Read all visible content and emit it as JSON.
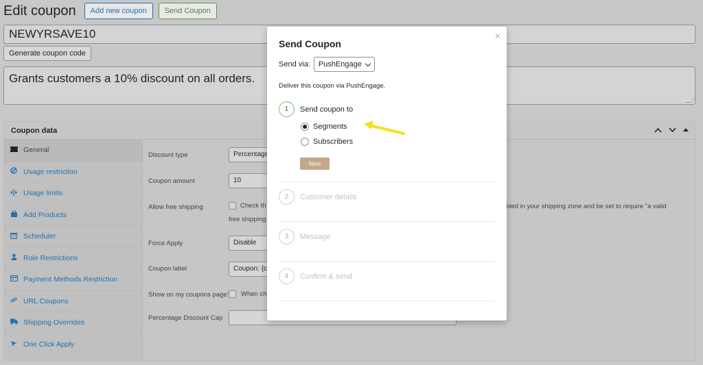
{
  "header": {
    "title": "Edit coupon",
    "add_new_label": "Add new coupon",
    "send_coupon_label": "Send Coupon"
  },
  "coupon_code": "NEWYRSAVE10",
  "generate_label": "Generate coupon code",
  "description": "Grants customers a 10% discount on all orders.",
  "panel": {
    "title": "Coupon data",
    "tabs": [
      {
        "label": "General",
        "icon": "ticket-icon"
      },
      {
        "label": "Usage restriction",
        "icon": "block-icon"
      },
      {
        "label": "Usage limits",
        "icon": "limits-icon"
      },
      {
        "label": "Add Products",
        "icon": "bag-icon"
      },
      {
        "label": "Scheduler",
        "icon": "calendar-icon"
      },
      {
        "label": "Role Restrictions",
        "icon": "user-icon"
      },
      {
        "label": "Payment Methods Restriction",
        "icon": "card-icon"
      },
      {
        "label": "URL Coupons",
        "icon": "link-icon"
      },
      {
        "label": "Shipping Overrides",
        "icon": "truck-icon"
      },
      {
        "label": "One Click Apply",
        "icon": "pointer-icon"
      }
    ]
  },
  "fields": {
    "discount_type_label": "Discount type",
    "discount_type_value": "Percentage",
    "coupon_amount_label": "Coupon amount",
    "coupon_amount_value": "10",
    "free_shipping_label": "Allow free shipping",
    "free_shipping_text_a": "Check th",
    "free_shipping_text_b": "bled in your shipping zone and be set to require \"a valid",
    "free_shipping_text_c": "free shipping",
    "force_apply_label": "Force Apply",
    "force_apply_value": "Disable",
    "coupon_label_label": "Coupon label",
    "coupon_label_value": "Coupon: {c",
    "show_coupons_label": "Show on my coupons page?",
    "show_coupons_text": "When ch",
    "pct_cap_label": "Percentage Discount Cap"
  },
  "modal": {
    "close": "×",
    "title": "Send Coupon",
    "send_via_label": "Send via:",
    "send_via_value": "PushEngage",
    "deliver_text": "Deliver this coupon via PushEngage.",
    "steps": [
      {
        "num": "1",
        "label": "Send coupon to"
      },
      {
        "num": "2",
        "label": "Customer details"
      },
      {
        "num": "3",
        "label": "Message"
      },
      {
        "num": "4",
        "label": "Confirm & send"
      }
    ],
    "options": [
      {
        "label": "Segments",
        "checked": true
      },
      {
        "label": "Subscribers",
        "checked": false
      }
    ],
    "next_label": "Next"
  },
  "colors": {
    "accent": "#2271b1",
    "next_button": "#c4a88a",
    "step_active_ring": "#7cc070",
    "annotation_arrow": "#f5e11a"
  }
}
